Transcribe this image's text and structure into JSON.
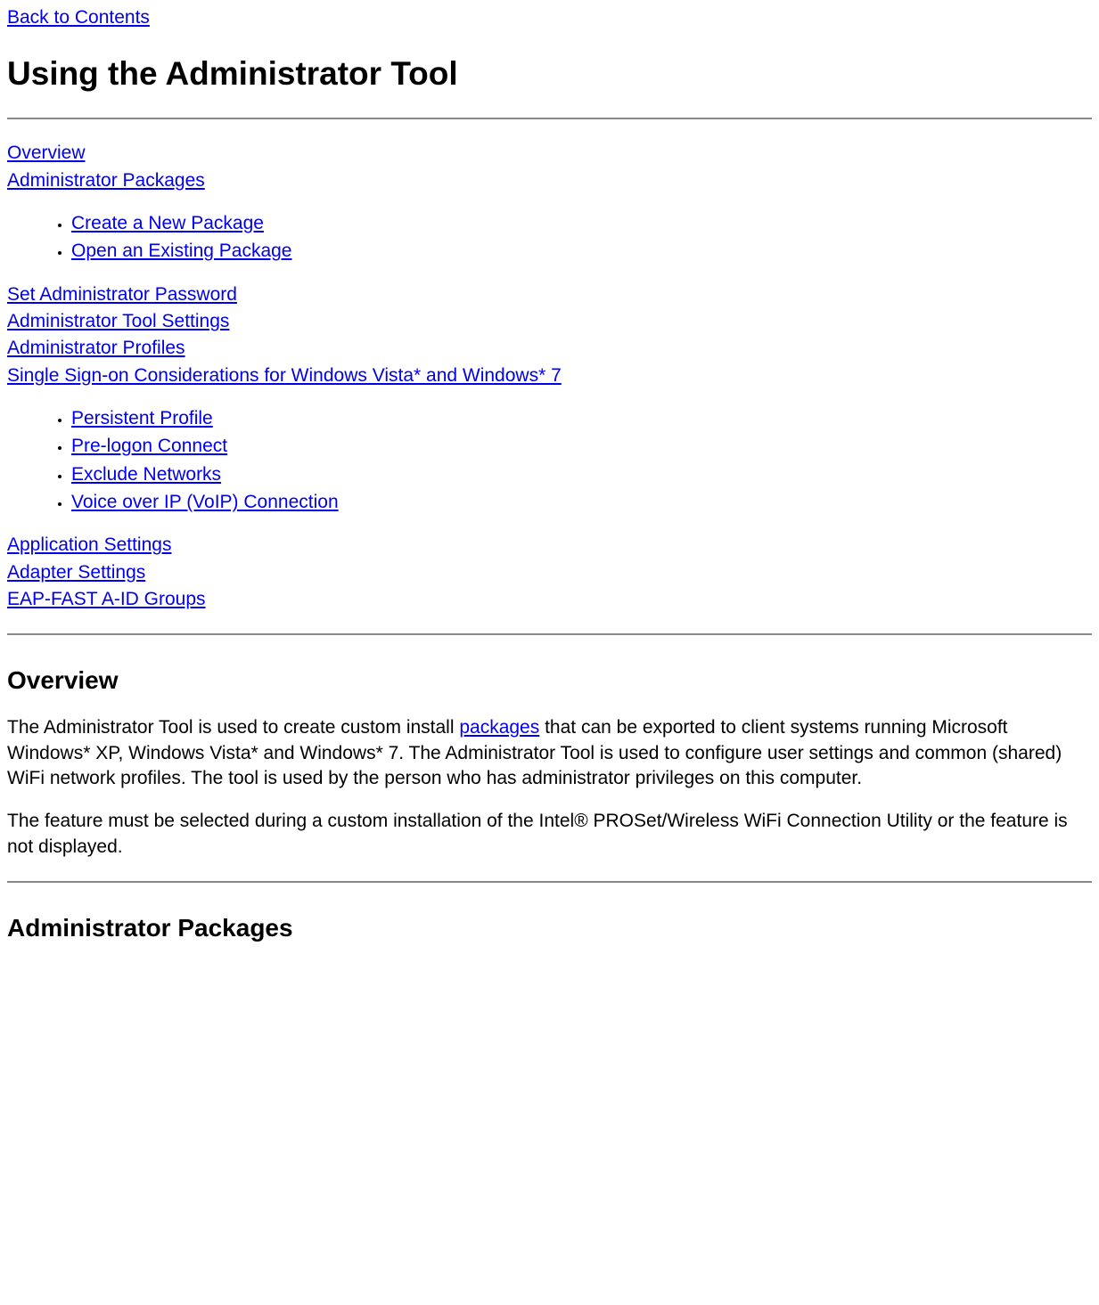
{
  "nav": {
    "back": "Back to Contents"
  },
  "title": "Using the Administrator Tool",
  "toc": {
    "overview": "Overview",
    "admin_packages": "Administrator Packages",
    "pkg_sub": {
      "create": "Create a New Package",
      "open": "Open an Existing Package"
    },
    "set_password": "Set Administrator Password",
    "tool_settings": "Administrator Tool Settings",
    "profiles": "Administrator Profiles",
    "sso": "Single Sign-on Considerations for Windows Vista* and Windows* 7 ",
    "sso_sub": {
      "persistent": "Persistent Profile ",
      "prelogon": "Pre-logon Connect",
      "exclude": "Exclude Networks",
      "voip": "Voice over IP (VoIP) Connection"
    },
    "app_settings": "Application Settings",
    "adapter_settings": "Adapter Settings",
    "eap": "EAP-FAST A-ID Groups"
  },
  "sections": {
    "overview_h": "Overview",
    "overview_p1_a": "The Administrator Tool is used to create custom install ",
    "overview_p1_link": "packages",
    "overview_p1_b": " that can be exported to client systems running Microsoft Windows* XP, Windows Vista* and Windows* 7. The Administrator Tool is used to configure user settings and common (shared) WiFi network profiles. The tool is used by the person who has administrator privileges on this computer.",
    "overview_p2": "The feature must be selected during a custom installation of the Intel® PROSet/Wireless WiFi Connection Utility or the feature is not displayed.",
    "admin_packages_h": "Administrator Packages"
  }
}
